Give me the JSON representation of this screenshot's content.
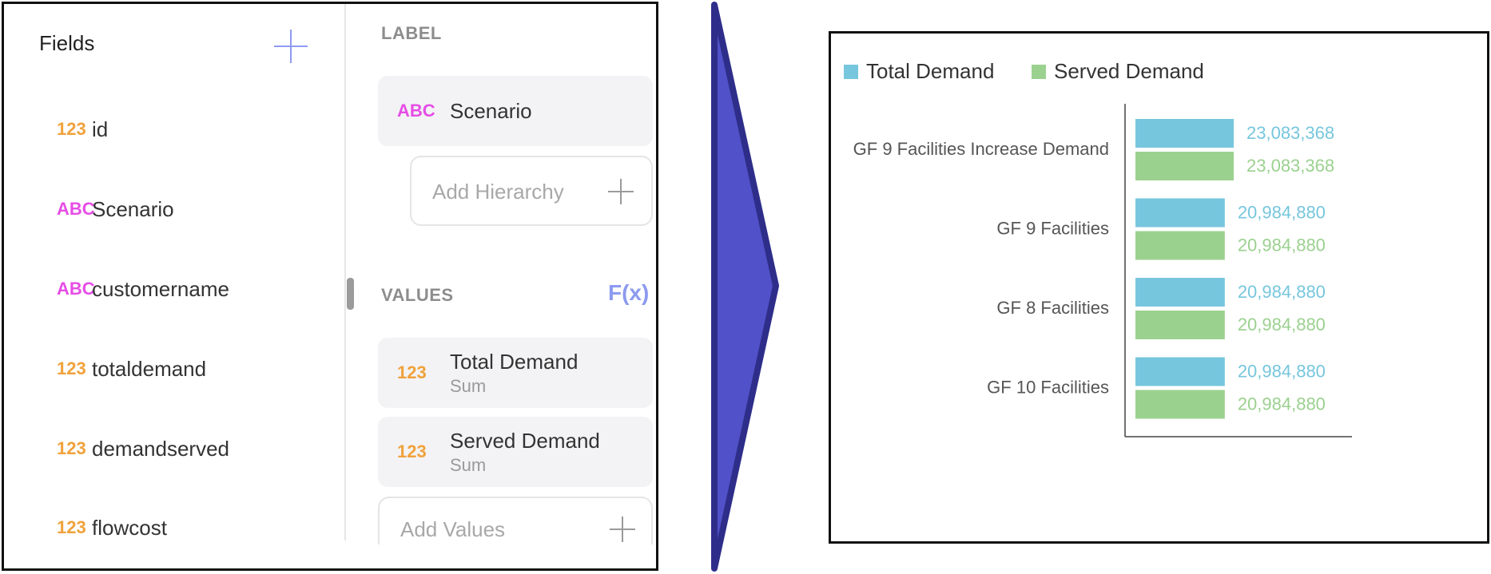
{
  "fields_panel": {
    "title": "Fields",
    "fields": [
      {
        "type": "123",
        "kind": "number",
        "name": "id"
      },
      {
        "type": "ABC",
        "kind": "text",
        "name": "Scenario"
      },
      {
        "type": "ABC",
        "kind": "text",
        "name": "customername"
      },
      {
        "type": "123",
        "kind": "number",
        "name": "totaldemand"
      },
      {
        "type": "123",
        "kind": "number",
        "name": "demandserved"
      },
      {
        "type": "123",
        "kind": "number",
        "name": "flowcost"
      }
    ]
  },
  "config_panel": {
    "label_section": {
      "title": "LABEL",
      "item": {
        "type": "ABC",
        "name": "Scenario"
      },
      "add_hierarchy": "Add Hierarchy"
    },
    "values_section": {
      "title": "VALUES",
      "fx_label": "F(x)",
      "items": [
        {
          "type": "123",
          "name": "Total Demand",
          "aggregation": "Sum"
        },
        {
          "type": "123",
          "name": "Served Demand",
          "aggregation": "Sum"
        }
      ],
      "add_values": "Add Values"
    }
  },
  "colors": {
    "number_type": "#f0a23b",
    "text_type": "#e64de6",
    "accent": "#8c9aef",
    "arrow_fill": "#5151c9",
    "arrow_stroke": "#2e2e8a",
    "total_demand": "#76c6dd",
    "served_demand": "#9bd18f"
  },
  "chart_data": {
    "type": "bar",
    "orientation": "horizontal",
    "legend_position": "top-left",
    "grid": false,
    "categories": [
      "GF 9 Facilities Increase Demand",
      "GF 9 Facilities",
      "GF 8 Facilities",
      "GF 10 Facilities"
    ],
    "series": [
      {
        "name": "Total Demand",
        "color": "#76c6dd",
        "values": [
          23083368,
          20984880,
          20984880,
          20984880
        ],
        "labels": [
          "23,083,368",
          "20,984,880",
          "20,984,880",
          "20,984,880"
        ]
      },
      {
        "name": "Served Demand",
        "color": "#9bd18f",
        "values": [
          23083368,
          20984880,
          20984880,
          20984880
        ],
        "labels": [
          "23,083,368",
          "20,984,880",
          "20,984,880",
          "20,984,880"
        ]
      }
    ]
  }
}
